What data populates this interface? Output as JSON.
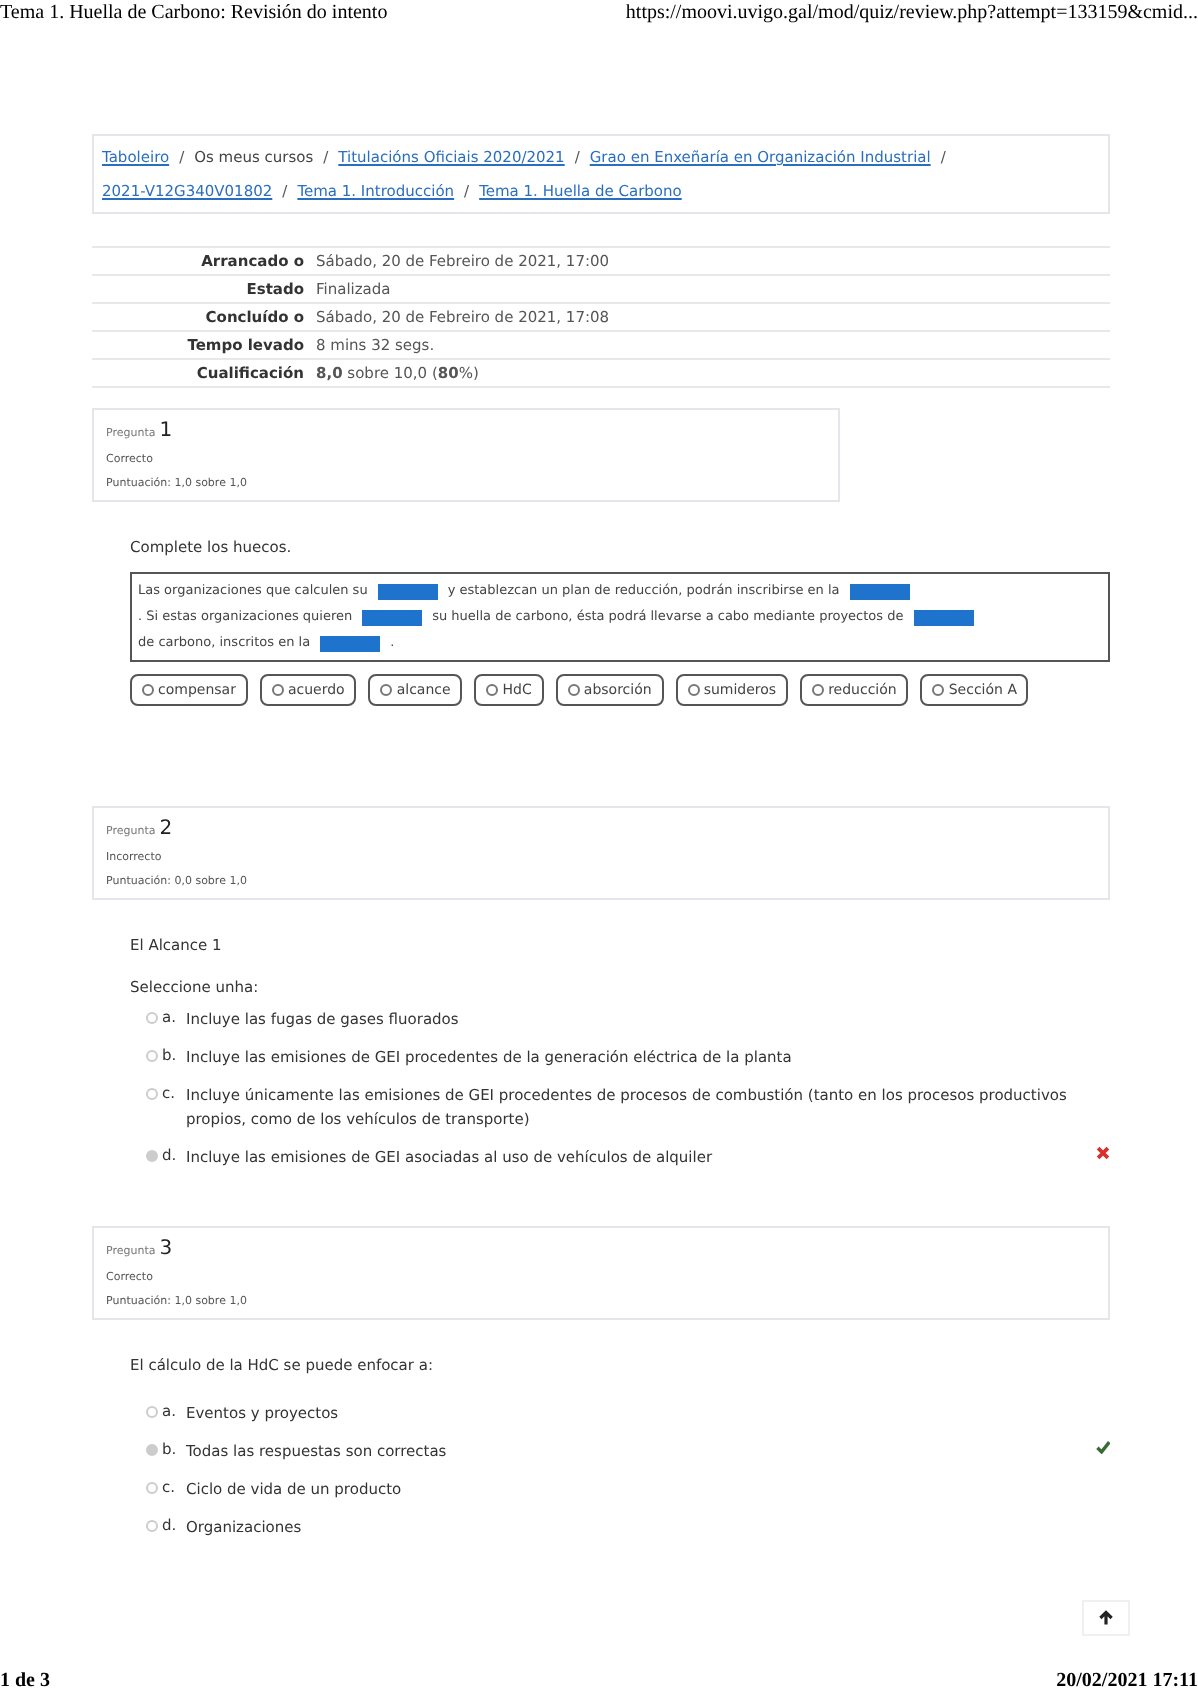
{
  "print_header": {
    "title": "Tema 1. Huella de Carbono: Revisión do intento",
    "url": "https://moovi.uvigo.gal/mod/quiz/review.php?attempt=133159&cmid..."
  },
  "breadcrumb": [
    {
      "label": "Taboleiro",
      "link": true
    },
    {
      "sep": "/",
      "label": "Os meus cursos",
      "link": false
    },
    {
      "sep": "/",
      "label": "Titulacións Oficiais 2020/2021",
      "link": true
    },
    {
      "sep": "/",
      "label": "Grao en Enxeñaría en Organización Industrial",
      "link": true
    },
    {
      "sep": "/",
      "label": "2021-V12G340V01802",
      "link": true
    },
    {
      "sep": "/",
      "label": "Tema 1. Introducción",
      "link": true
    },
    {
      "sep": "/",
      "label": "Tema 1. Huella de Carbono",
      "link": true
    }
  ],
  "summary": [
    {
      "label": "Arrancado o",
      "value": "Sábado, 20 de Febreiro de 2021, 17:00"
    },
    {
      "label": "Estado",
      "value": "Finalizada"
    },
    {
      "label": "Concluído o",
      "value": "Sábado, 20 de Febreiro de 2021, 17:08"
    },
    {
      "label": "Tempo levado",
      "value": "8 mins 32 segs."
    },
    {
      "label": "Cualificación",
      "value": "**8,0** sobre 10,0 (**80**%)"
    }
  ],
  "questions": [
    {
      "kind": "gapfill",
      "label": "Pregunta",
      "number": "1",
      "status": "Correcto",
      "score": "Puntuación: 1,0 sobre 1,0",
      "prompt": "Complete los huecos.",
      "segments": [
        {
          "kind": "text",
          "text": "Las organizaciones que calculen su"
        },
        {
          "kind": "blank"
        },
        {
          "kind": "text",
          "text": "y establezcan un plan de reducción, podrán inscribirse en la"
        },
        {
          "kind": "blank"
        },
        {
          "kind": "text",
          "text": ". Si estas organizaciones quieren"
        },
        {
          "kind": "blank"
        },
        {
          "kind": "text",
          "text": "su huella de carbono, ésta podrá llevarse a cabo mediante proyectos de"
        },
        {
          "kind": "blank"
        },
        {
          "kind": "text",
          "text": "de carbono, inscritos en la"
        },
        {
          "kind": "blank"
        },
        {
          "kind": "text",
          "text": "."
        }
      ],
      "chips": [
        "compensar",
        "acuerdo",
        "alcance",
        "HdC",
        "absorción",
        "sumideros",
        "reducción",
        "Sección A"
      ]
    },
    {
      "kind": "choice",
      "label": "Pregunta",
      "number": "2",
      "status": "Incorrecto",
      "score": "Puntuación: 0,0 sobre 1,0",
      "prompt": "El Alcance 1",
      "instruction": "Seleccione unha:",
      "options": [
        {
          "letter": "a.",
          "text": "Incluye las fugas de gases fluorados",
          "selected": false
        },
        {
          "letter": "b.",
          "text": "Incluye las emisiones de GEI procedentes de la generación eléctrica de la planta",
          "selected": false
        },
        {
          "letter": "c.",
          "text": "Incluye únicamente las emisiones de GEI procedentes de procesos de combustión (tanto en los procesos productivos propios, como de los vehículos de transporte)",
          "selected": false
        },
        {
          "letter": "d.",
          "text": "Incluye las emisiones de GEI asociadas al uso de vehículos de alquiler",
          "selected": true,
          "correct": false
        }
      ]
    },
    {
      "kind": "choice",
      "label": "Pregunta",
      "number": "3",
      "status": "Correcto",
      "score": "Puntuación: 1,0 sobre 1,0",
      "prompt": "El cálculo de la HdC se puede enfocar a:",
      "options": [
        {
          "letter": "a.",
          "text": "Eventos y proyectos",
          "selected": false
        },
        {
          "letter": "b.",
          "text": "Todas las respuestas son correctas",
          "selected": true,
          "correct": true
        },
        {
          "letter": "c.",
          "text": "Ciclo de vida de un producto",
          "selected": false
        },
        {
          "letter": "d.",
          "text": "Organizaciones",
          "selected": false
        }
      ]
    }
  ],
  "print_footer": {
    "page": "1 de 3",
    "date": "20/02/2021 17:11"
  }
}
